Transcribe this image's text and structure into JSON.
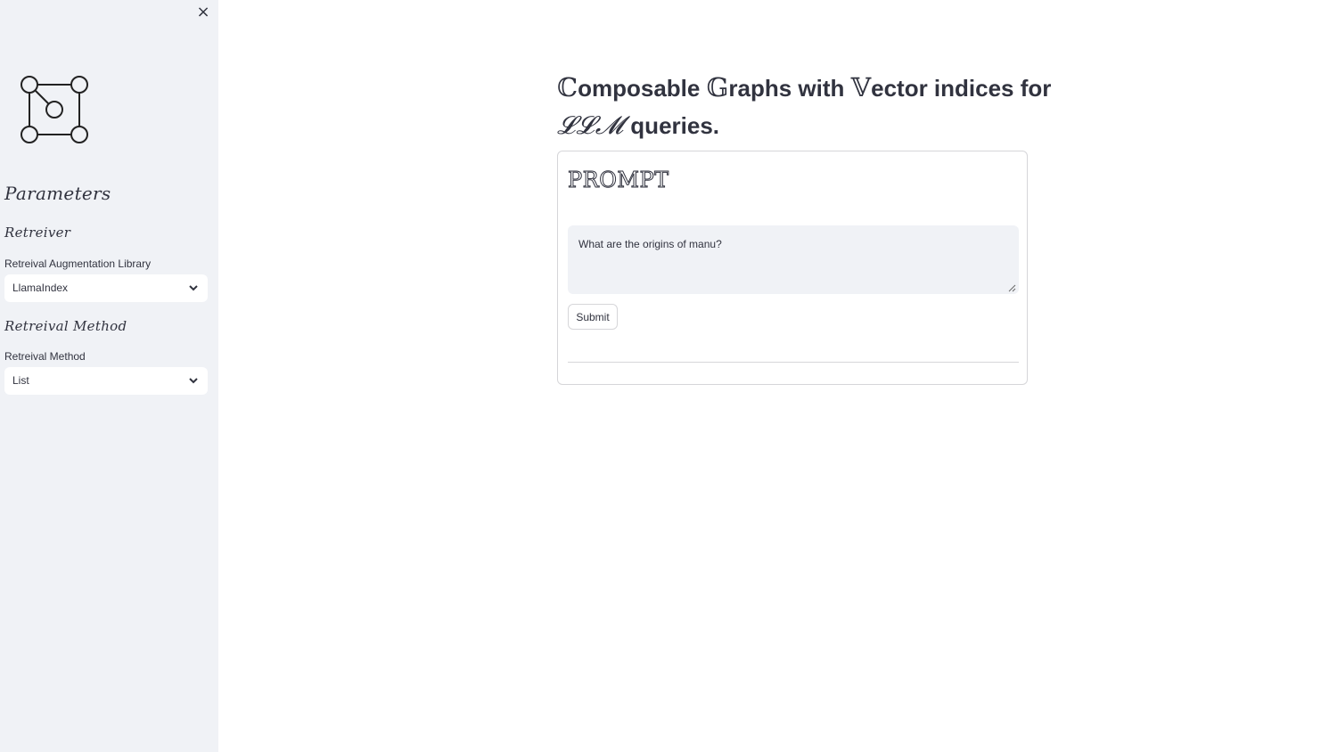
{
  "sidebar": {
    "close_icon": "×",
    "parameters_heading": "Parameters",
    "retreiver_heading": "Retreiver",
    "library_label": "Retreival Augmentation Library",
    "library_value": "LlamaIndex",
    "method_heading": "Retreival Method",
    "method_label": "Retreival Method",
    "method_value": "List"
  },
  "main": {
    "title_parts": {
      "c": "ℂ",
      "omposable": "omposable ",
      "g": "𝔾",
      "raphs": "raphs with ",
      "v": "𝕍",
      "ector": "ector indices for",
      "llm": "𝓛𝓛𝓜",
      "queries": " queries."
    },
    "prompt_heading": "PROMPT",
    "prompt_value": "What are the origins of manu?",
    "submit_label": "Submit"
  }
}
